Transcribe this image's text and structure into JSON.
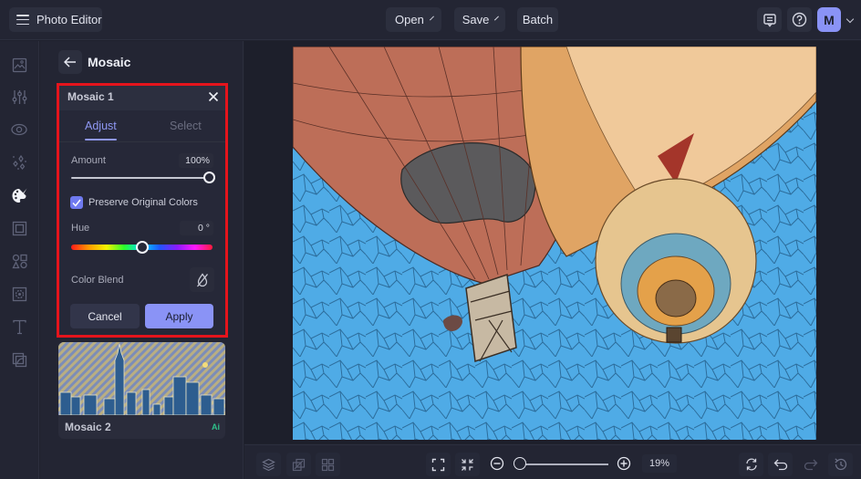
{
  "topbar": {
    "app_title": "Photo Editor",
    "open_label": "Open",
    "save_label": "Save",
    "batch_label": "Batch",
    "avatar_initial": "M"
  },
  "left_rail": {
    "items": [
      {
        "name": "image-icon",
        "active": false
      },
      {
        "name": "adjustments-icon",
        "active": false
      },
      {
        "name": "eye-icon",
        "active": false
      },
      {
        "name": "sparkles-icon",
        "active": false
      },
      {
        "name": "artsy-palette-icon",
        "active": true
      },
      {
        "name": "frame-icon",
        "active": false
      },
      {
        "name": "shapes-icon",
        "active": false
      },
      {
        "name": "texture-icon",
        "active": false
      },
      {
        "name": "text-icon",
        "active": false
      },
      {
        "name": "overlay-icon",
        "active": false
      }
    ]
  },
  "panel": {
    "title": "Mosaic",
    "effect_card": {
      "title": "Mosaic 1",
      "tabs": [
        {
          "label": "Adjust",
          "active": true
        },
        {
          "label": "Select",
          "active": false
        }
      ],
      "amount_label": "Amount",
      "amount_value": "100%",
      "amount_fraction": 1.0,
      "preserve_colors_label": "Preserve Original Colors",
      "preserve_colors_checked": true,
      "hue_label": "Hue",
      "hue_value": "0 °",
      "hue_slider_fraction": 0.5,
      "color_blend_label": "Color Blend",
      "cancel_label": "Cancel",
      "apply_label": "Apply"
    },
    "presets": [
      {
        "name": "Mosaic 2",
        "badge": "Ai"
      }
    ]
  },
  "bottombar": {
    "zoom_value": "19%",
    "zoom_fraction": 0.0
  },
  "colors": {
    "accent": "#8a93f6",
    "highlight_frame": "#e5141c",
    "ai_badge": "#2fc18a"
  }
}
